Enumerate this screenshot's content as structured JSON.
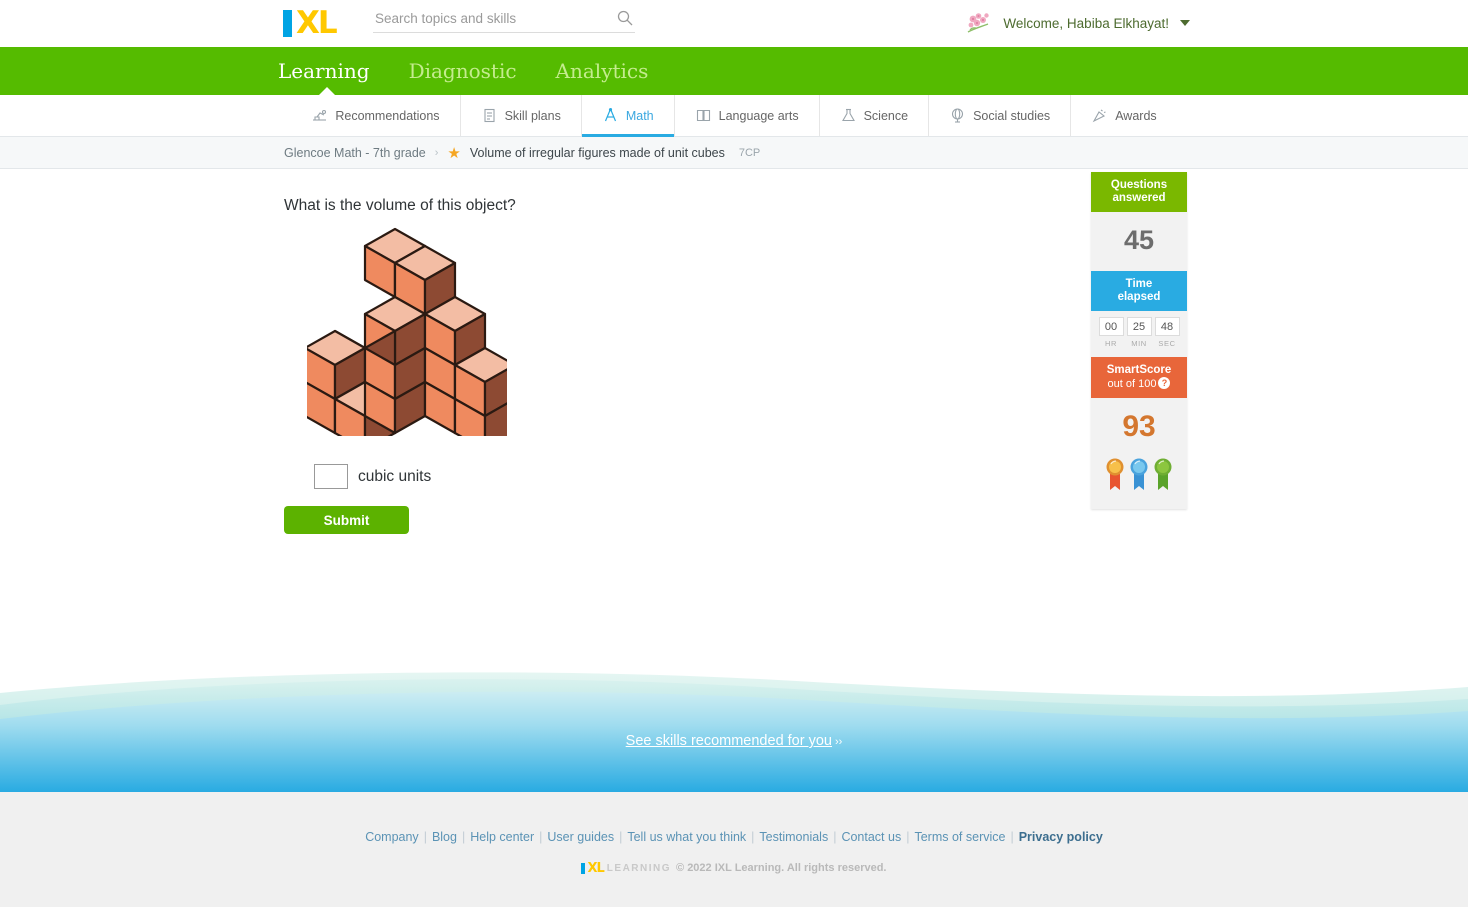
{
  "header": {
    "logo_text": "IXL",
    "search_placeholder": "Search topics and skills",
    "search_value": "",
    "search_icon": "search-icon",
    "welcome_text": "Welcome, Habiba Elkhayat!",
    "avatar_icon": "cherry-blossom-avatar"
  },
  "primary_nav": {
    "items": [
      {
        "label": "Learning",
        "active": true
      },
      {
        "label": "Diagnostic",
        "active": false
      },
      {
        "label": "Analytics",
        "active": false
      }
    ],
    "active_color": "#ffffff",
    "bar_color": "#55bb00"
  },
  "subject_tabs": [
    {
      "label": "Recommendations",
      "icon": "recommendations-icon",
      "active": false
    },
    {
      "label": "Skill plans",
      "icon": "skill-plans-icon",
      "active": false
    },
    {
      "label": "Math",
      "icon": "math-compass-icon",
      "active": true
    },
    {
      "label": "Language arts",
      "icon": "language-arts-book-icon",
      "active": false
    },
    {
      "label": "Science",
      "icon": "science-flask-icon",
      "active": false
    },
    {
      "label": "Social studies",
      "icon": "social-studies-globe-icon",
      "active": false
    },
    {
      "label": "Awards",
      "icon": "awards-confetti-icon",
      "active": false
    }
  ],
  "breadcrumb": {
    "course": "Glencoe Math - 7th grade",
    "separator": "›",
    "star_icon": "favorite-star-icon",
    "skill": "Volume of irregular figures made of unit cubes",
    "code": "7CP"
  },
  "question": {
    "prompt": "What is the volume of this object?",
    "figure_description": "isometric-unit-cube-stack",
    "answer_value": "",
    "unit_label": "cubic units",
    "submit_label": "Submit"
  },
  "figure_colors": {
    "top_face": "#f3bda4",
    "left_face": "#ef8a5f",
    "right_face": "#8d4a33",
    "outline": "#2b1a12"
  },
  "score_panel": {
    "questions_answered_label_line1": "Questions",
    "questions_answered_label_line2": "answered",
    "questions_answered_value": "45",
    "questions_header_color": "#7ab800",
    "time_label_line1": "Time",
    "time_label_line2": "elapsed",
    "time_header_color": "#29abe2",
    "time": {
      "hr": "00",
      "min": "25",
      "sec": "48",
      "hr_label": "HR",
      "min_label": "MIN",
      "sec_label": "SEC"
    },
    "smartscore_label": "SmartScore",
    "smartscore_sub": "out of 100",
    "smartscore_help_icon": "question-mark-help-icon",
    "smartscore_header_color": "#e8663a",
    "smartscore_value": "93",
    "smartscore_value_color": "#d4772f",
    "ribbons": [
      {
        "name": "ribbon-award-orange",
        "color": "#f0a93c",
        "tail": "#e8542f"
      },
      {
        "name": "ribbon-award-blue",
        "color": "#6cc4ea",
        "tail": "#3a92d4"
      },
      {
        "name": "ribbon-award-green",
        "color": "#8cc63f",
        "tail": "#5aa32a"
      }
    ],
    "scratchpad_icon": "pencil-scratchpad-icon",
    "scratchpad_color": "#29abe2"
  },
  "recommend_band": {
    "link_text": "See skills recommended for you",
    "chevrons": "››"
  },
  "footer": {
    "links": [
      {
        "label": "Company",
        "bold": false
      },
      {
        "label": "Blog",
        "bold": false
      },
      {
        "label": "Help center",
        "bold": false
      },
      {
        "label": "User guides",
        "bold": false
      },
      {
        "label": "Tell us what you think",
        "bold": false
      },
      {
        "label": "Testimonials",
        "bold": false
      },
      {
        "label": "Contact us",
        "bold": false
      },
      {
        "label": "Terms of service",
        "bold": false
      },
      {
        "label": "Privacy policy",
        "bold": true
      }
    ],
    "separator": "|",
    "logo_text": "IXL",
    "logo_word": "LEARNING",
    "copyright": "© 2022 IXL Learning. All rights reserved."
  }
}
